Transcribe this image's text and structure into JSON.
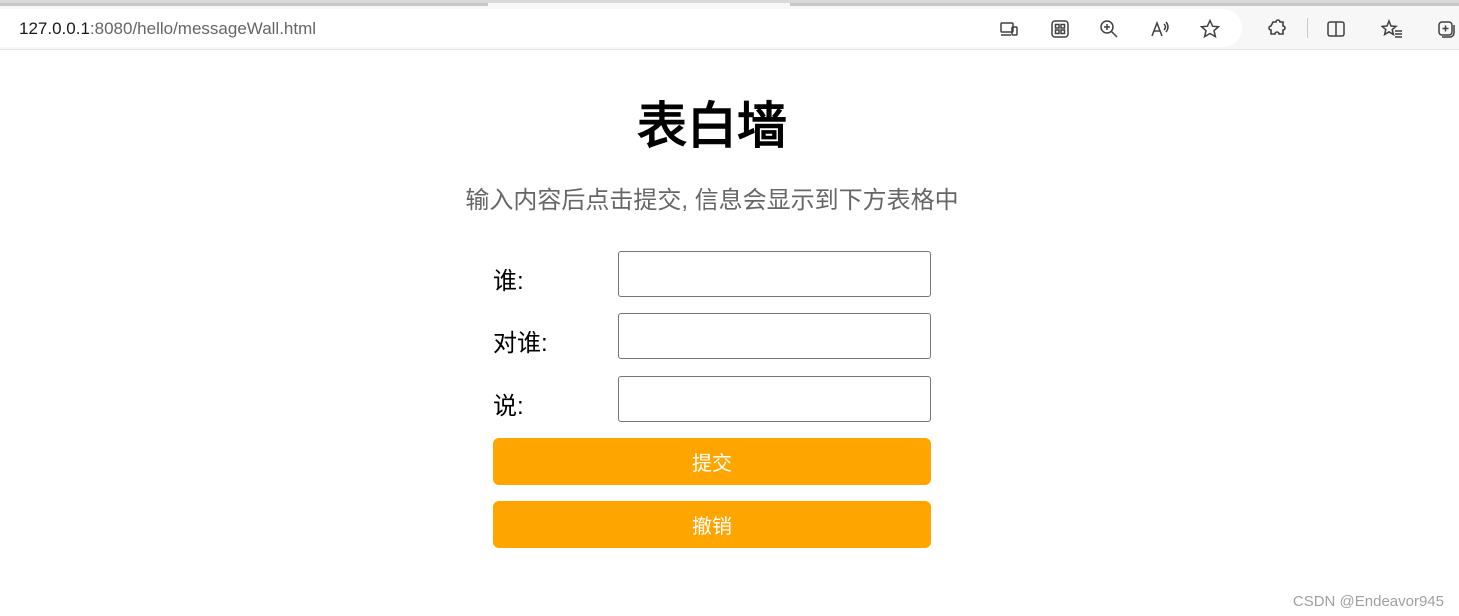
{
  "browser": {
    "url_host": "127.0.0.1",
    "url_rest": ":8080/hello/messageWall.html",
    "icons": [
      "device-icon",
      "apps-icon",
      "zoom-icon",
      "read-aloud-icon",
      "favorite-star-icon",
      "extensions-icon",
      "split-screen-icon",
      "favorites-list-icon",
      "collections-icon"
    ]
  },
  "page": {
    "title": "表白墙",
    "subtitle": "输入内容后点击提交, 信息会显示到下方表格中",
    "fields": [
      {
        "label": "谁:",
        "value": "",
        "placeholder": ""
      },
      {
        "label": "对谁:",
        "value": "",
        "placeholder": ""
      },
      {
        "label": "说:",
        "value": "",
        "placeholder": ""
      }
    ],
    "submit_label": "提交",
    "cancel_label": "撤销",
    "accent_color": "#ffa500"
  },
  "watermark": "CSDN @Endeavor945"
}
